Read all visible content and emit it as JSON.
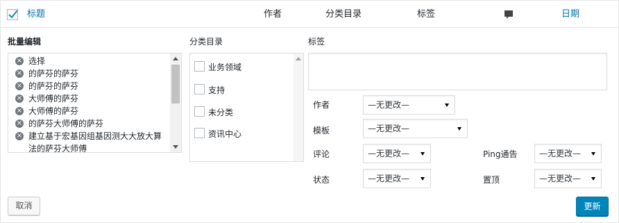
{
  "header": {
    "title_label": "标题",
    "author_label": "作者",
    "category_label": "分类目录",
    "tags_label": "标签",
    "comments_icon": "comment-bubble-icon",
    "date_label": "日期"
  },
  "bulk_edit": {
    "title": "批量编辑",
    "posts": [
      "选择",
      "的萨芬的萨芬",
      "的萨芬的萨芬",
      "大师傅的萨芬",
      "大师傅的萨芬",
      "的萨芬大师傅的萨芬",
      "建立基于宏基因组基因测大大放大算",
      "法的萨芬大师傅"
    ]
  },
  "categories": {
    "title": "分类目录",
    "items": [
      "业务领域",
      "支持",
      "未分类",
      "资讯中心"
    ]
  },
  "tags": {
    "title": "标签",
    "value": ""
  },
  "fields": {
    "author_label": "作者",
    "author_value": "—无更改—",
    "template_label": "模板",
    "template_value": "—无更改—",
    "comments_label": "评论",
    "comments_value": "—无更改—",
    "ping_label": "Ping通告",
    "ping_value": "—无更改—",
    "status_label": "状态",
    "status_value": "—无更改—",
    "sticky_label": "置顶",
    "sticky_value": "—无更改—"
  },
  "actions": {
    "cancel_label": "取消",
    "update_label": "更新"
  },
  "colors": {
    "link": "#0073aa",
    "primary_button": "#0085ba"
  }
}
